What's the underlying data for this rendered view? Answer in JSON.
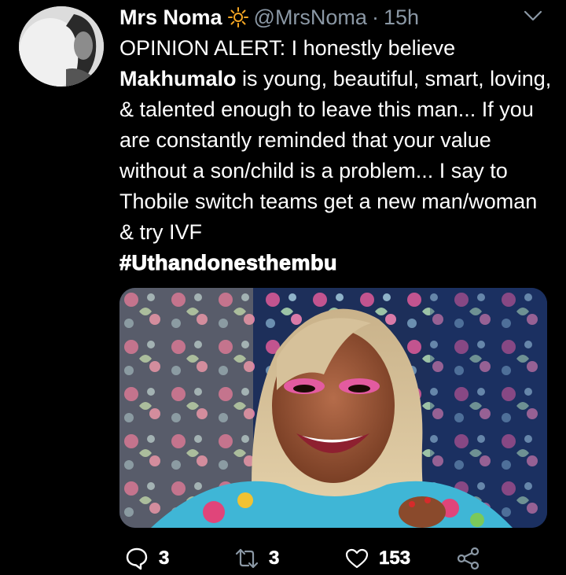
{
  "tweet": {
    "author_name": "Mrs Noma",
    "author_emoji": "sun-emoji",
    "handle": "@MrsNoma",
    "separator": "·",
    "timestamp": "15h",
    "text_line1_prefix": "OPINION ALERT: I honestly believe",
    "text_bold_name": "Makhumalo",
    "text_rest": " is young, beautiful, smart, loving, & talented enough to leave this man... If you are constantly reminded that your value without a son/child is a problem... I say to Thobile switch teams get a new man/woman & try IVF",
    "hashtag": "#Uthandonesthembu"
  },
  "actions": {
    "reply_count": "3",
    "retweet_count": "3",
    "like_count": "153"
  },
  "icons": {
    "reply": "speech-bubble-icon",
    "retweet": "retweet-icon",
    "like": "heart-icon",
    "share": "share-icon",
    "menu": "chevron-down-icon"
  }
}
